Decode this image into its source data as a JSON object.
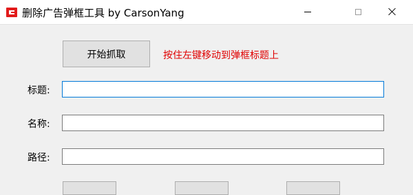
{
  "window": {
    "title": "删除广告弹框工具 by CarsonYang",
    "icon": "app-logo-icon"
  },
  "controls": {
    "start_button": "开始抓取",
    "hint": "按住左键移动到弹框标题上",
    "hint_color": "#e00000"
  },
  "fields": {
    "title_label": "标题:",
    "title_value": "",
    "name_label": "名称:",
    "name_value": "",
    "path_label": "路径:",
    "path_value": ""
  },
  "accent_color": "#0078d7"
}
